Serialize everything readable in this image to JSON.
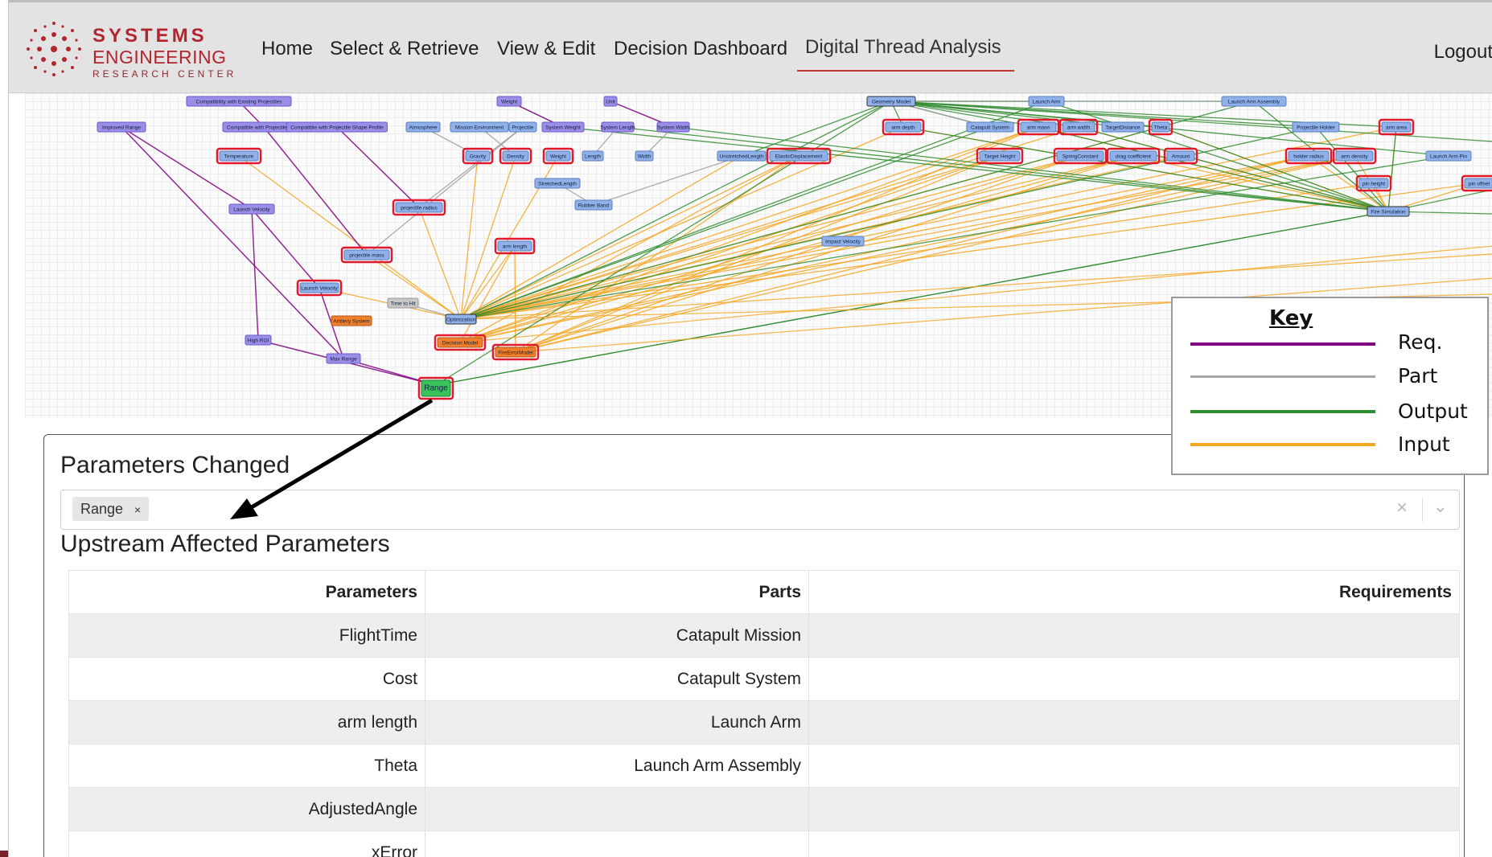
{
  "brand": {
    "line1": "SYSTEMS",
    "line2": "ENGINEERING",
    "line3": "RESEARCH CENTER",
    "color": "#b3252e"
  },
  "nav": {
    "items": [
      "Home",
      "Select & Retrieve",
      "View & Edit",
      "Decision Dashboard",
      "Digital Thread Analysis"
    ],
    "active": "Digital Thread Analysis",
    "logout": "Logout"
  },
  "graph": {
    "nodes": [
      {
        "label": "Compatibility with Existing Projectiles",
        "kind": "req",
        "flag": false
      },
      {
        "label": "Weight",
        "kind": "req",
        "flag": false
      },
      {
        "label": "Unit",
        "kind": "req",
        "flag": false
      },
      {
        "label": "Geometry Model",
        "kind": "model",
        "flag": false
      },
      {
        "label": "Launch Arm",
        "kind": "part",
        "flag": false
      },
      {
        "label": "Launch Arm Assembly",
        "kind": "part",
        "flag": false
      },
      {
        "label": "Improved Range",
        "kind": "req",
        "flag": false
      },
      {
        "label": "Compatible with Projectile Mass",
        "kind": "req",
        "flag": false
      },
      {
        "label": "Compatible with Projectile Shape Profile",
        "kind": "req",
        "flag": false
      },
      {
        "label": "Atmosphere",
        "kind": "part",
        "flag": false
      },
      {
        "label": "Mission Environment",
        "kind": "part",
        "flag": false
      },
      {
        "label": "Projectile",
        "kind": "part",
        "flag": false
      },
      {
        "label": "System Weight",
        "kind": "req",
        "flag": false
      },
      {
        "label": "System Length",
        "kind": "req",
        "flag": false
      },
      {
        "label": "System Width",
        "kind": "req",
        "flag": false
      },
      {
        "label": "arm depth",
        "kind": "param",
        "flag": true
      },
      {
        "label": "Catapult System",
        "kind": "part",
        "flag": false
      },
      {
        "label": "arm mass",
        "kind": "param",
        "flag": true
      },
      {
        "label": "arm width",
        "kind": "param",
        "flag": true
      },
      {
        "label": "TargetDistance",
        "kind": "part",
        "flag": false
      },
      {
        "label": "Theta",
        "kind": "param",
        "flag": true
      },
      {
        "label": "Projectile Holder",
        "kind": "part",
        "flag": false
      },
      {
        "label": "arm area",
        "kind": "param",
        "flag": true
      },
      {
        "label": "Temperature",
        "kind": "param",
        "flag": true
      },
      {
        "label": "Gravity",
        "kind": "param",
        "flag": true
      },
      {
        "label": "Density",
        "kind": "param",
        "flag": true
      },
      {
        "label": "Weight",
        "kind": "param",
        "flag": true
      },
      {
        "label": "Length",
        "kind": "part",
        "flag": false
      },
      {
        "label": "Width",
        "kind": "part",
        "flag": false
      },
      {
        "label": "UnstretchedLength",
        "kind": "part",
        "flag": false
      },
      {
        "label": "ElasticDisplacement",
        "kind": "param",
        "flag": true
      },
      {
        "label": "Target Height",
        "kind": "param",
        "flag": true
      },
      {
        "label": "SpringConstant",
        "kind": "param",
        "flag": true
      },
      {
        "label": "drag coefficient",
        "kind": "param",
        "flag": true
      },
      {
        "label": "Amount",
        "kind": "param",
        "flag": true
      },
      {
        "label": "holder radius",
        "kind": "param",
        "flag": true
      },
      {
        "label": "arm density",
        "kind": "param",
        "flag": true
      },
      {
        "label": "Launch Arm Pin",
        "kind": "part",
        "flag": false
      },
      {
        "label": "Launch Velocity",
        "kind": "req",
        "flag": false
      },
      {
        "label": "StretchedLength",
        "kind": "part",
        "flag": false
      },
      {
        "label": "Rubber Band",
        "kind": "part",
        "flag": false
      },
      {
        "label": "projectile radius",
        "kind": "param",
        "flag": true
      },
      {
        "label": "pin height",
        "kind": "param",
        "flag": true
      },
      {
        "label": "pin offset",
        "kind": "param",
        "flag": true
      },
      {
        "label": "Fire Simulation",
        "kind": "model",
        "flag": false
      },
      {
        "label": "arm length",
        "kind": "param",
        "flag": true
      },
      {
        "label": "Impact Velocity",
        "kind": "part",
        "flag": false
      },
      {
        "label": "projectile mass",
        "kind": "param",
        "flag": true
      },
      {
        "label": "Launch Velocity",
        "kind": "param",
        "flag": true
      },
      {
        "label": "Time to Hit",
        "kind": "gray",
        "flag": false
      },
      {
        "label": "Optimization",
        "kind": "model",
        "flag": false
      },
      {
        "label": "Artillery System",
        "kind": "orange",
        "flag": false
      },
      {
        "label": "Decision Model",
        "kind": "orange",
        "flag": true
      },
      {
        "label": "FireErrorModel",
        "kind": "orange",
        "flag": true
      },
      {
        "label": "High ROI",
        "kind": "req",
        "flag": false
      },
      {
        "label": "Max Range",
        "kind": "req",
        "flag": false
      },
      {
        "label": "Range",
        "kind": "range",
        "flag": true
      }
    ],
    "colors": {
      "req": "#800080",
      "part": "#9e9e9e",
      "output": "#2e8b2e",
      "input": "#f5a623"
    }
  },
  "key": {
    "title": "Key",
    "items": [
      {
        "label": "Req.",
        "color": "#800080"
      },
      {
        "label": "Part",
        "color": "#a6a6a6"
      },
      {
        "label": "Output",
        "color": "#2e8b2e"
      },
      {
        "label": "Input",
        "color": "#f5a623"
      }
    ]
  },
  "parameters_changed": {
    "title": "Parameters Changed",
    "selected": [
      {
        "label": "Range",
        "remove": "×"
      }
    ],
    "clear": "×",
    "dropdown": "⌄"
  },
  "upstream": {
    "title": "Upstream Affected Parameters",
    "columns": [
      "Parameters",
      "Parts",
      "Requirements"
    ],
    "rows": [
      {
        "param": "FlightTime",
        "part": "Catapult Mission",
        "req": ""
      },
      {
        "param": "Cost",
        "part": "Catapult System",
        "req": ""
      },
      {
        "param": "arm length",
        "part": "Launch Arm",
        "req": ""
      },
      {
        "param": "Theta",
        "part": "Launch Arm Assembly",
        "req": ""
      },
      {
        "param": "AdjustedAngle",
        "part": "",
        "req": ""
      },
      {
        "param": "xError",
        "part": "",
        "req": ""
      }
    ]
  }
}
